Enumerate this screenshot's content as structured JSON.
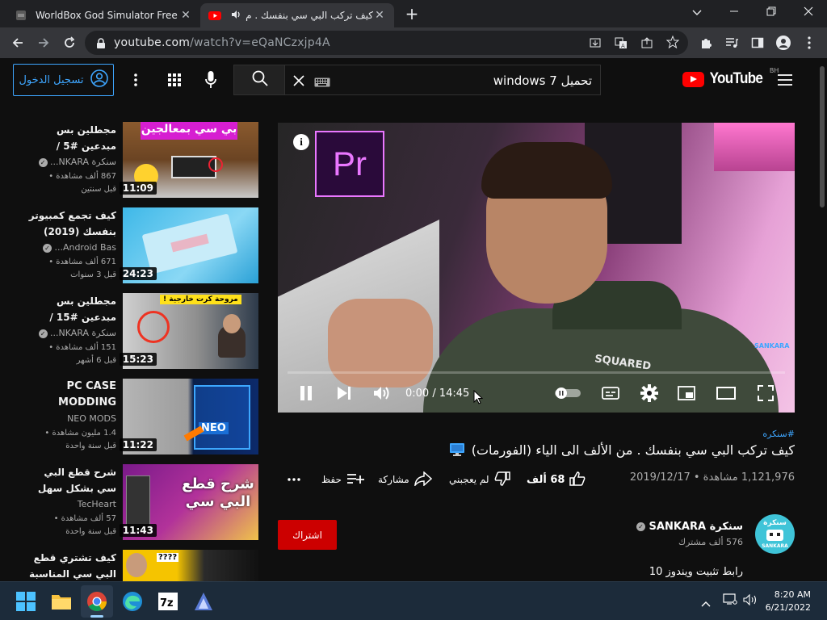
{
  "browser": {
    "tabs": [
      {
        "title": "WorldBox God Simulator Free Do"
      },
      {
        "title": "كيف تركب البي سي بنفسك . مِ"
      }
    ],
    "url_host": "youtube.com",
    "url_path": "/watch?v=eQaNCzxjp4A"
  },
  "header": {
    "signin_label": "تسجيل الدخول",
    "search_value": "تحميل windows 7",
    "logo_text": "YouTube",
    "country_code": "BH"
  },
  "recommendations": [
    {
      "title": "مجطلين بس مبدعين #5 / كمبيوتر قيه...",
      "channel": "سنكرة NKARA...",
      "views": "867 ألف مشاهدة •",
      "age": "قبل سنتين",
      "duration": "11:09",
      "thumb_text": "بي سي بمعالجين"
    },
    {
      "title": "كيف تجمع كمبيوتر بنفسك (2019) -...",
      "channel": "Android Bas...",
      "views": "671 ألف مشاهدة •",
      "age": "قبل 3 سنوات",
      "duration": "24:23",
      "thumb_text": ""
    },
    {
      "title": "مجطلين بس مبدعين #15 / مراوح...",
      "channel": "سنكرة NKARA...",
      "views": "151 ألف مشاهدة •",
      "age": "قبل 6 أشهر",
      "duration": "15:23",
      "thumb_text": "مروحة كرت خارجية !"
    },
    {
      "title": "PC CASE MODDING",
      "channel": "NEO MODS",
      "views": "1.4 مليون مشاهدة •",
      "age": "قبل سنة واحدة",
      "duration": "11:22",
      "thumb_text": "NEO"
    },
    {
      "title": "شرح قطع البي سي بشكل سهل ومبسط",
      "channel": "TecHeart",
      "views": "57 ألف مشاهدة •",
      "age": "قبل سنة واحدة",
      "duration": "11:43",
      "thumb_text": "شرح قطع البي سي"
    },
    {
      "title": "كيف تشتري قطع البي سي المناسبة ؟؟...",
      "channel": "",
      "views": "",
      "age": "",
      "duration": "",
      "thumb_text": "????"
    }
  ],
  "player": {
    "time": "0:00 / 14:45",
    "pr_label": "Pr",
    "watermark": "SANKARA",
    "shirt_text": "SQUARED",
    "progress": 0
  },
  "video": {
    "hashtag": "#سنكره",
    "title": "كيف تركب البي سي بنفسك . من الألف الى الياء (الفورمات)",
    "views": "1,121,976 مشاهدة • 2019/12/17",
    "likes": "68 ألف",
    "dislike_label": "لم يعجبني",
    "share_label": "مشاركة",
    "save_label": "حفظ",
    "subscribe_label": "اشتراك",
    "channel_name": "سنكرة SANKARA",
    "channel_subs": "576 ألف مشترك",
    "avatar_text": "سنكرة",
    "avatar_sub": "SANKARA",
    "description": "رابط تثبيت ويندوز 10"
  },
  "taskbar": {
    "time": "8:20 AM",
    "date": "6/21/2022",
    "apps": [
      "windows-start",
      "file-explorer",
      "chrome",
      "edge",
      "7zip",
      "app"
    ]
  },
  "colors": {
    "accent_blue": "#3ea6ff",
    "subscribe_red": "#cc0000",
    "youtube_red": "#ff0000",
    "premiere_purple": "#ea77ff"
  }
}
